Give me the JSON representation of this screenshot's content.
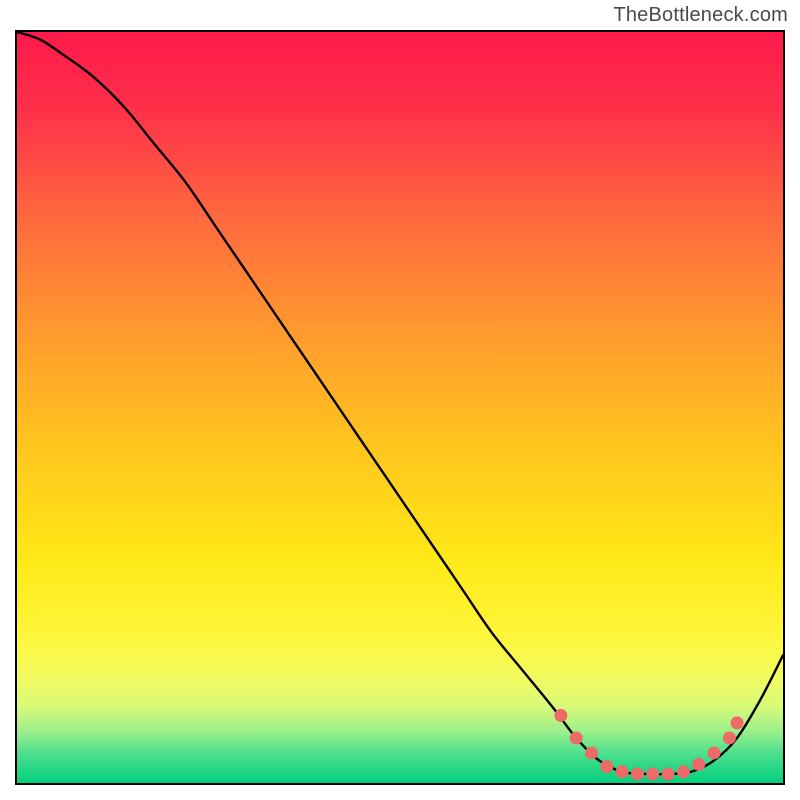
{
  "watermark": "TheBottleneck.com",
  "colors": {
    "curve": "#000000",
    "marker": "#ee6a66",
    "gradient_top": "#ff1a4b",
    "gradient_mid": "#ffe817",
    "gradient_bottom": "#00cf7d"
  },
  "chart_data": {
    "type": "line",
    "title": "",
    "xlabel": "",
    "ylabel": "",
    "xlim": [
      0,
      100
    ],
    "ylim": [
      0,
      100
    ],
    "grid": false,
    "legend": false,
    "series": [
      {
        "name": "bottleneck-curve",
        "x": [
          0,
          3,
          6,
          10,
          14,
          18,
          22,
          26,
          30,
          34,
          38,
          42,
          46,
          50,
          54,
          58,
          62,
          66,
          70,
          73,
          76,
          79,
          82,
          85,
          88,
          91,
          94,
          97,
          100
        ],
        "y": [
          100,
          99,
          97,
          94,
          90,
          85,
          80,
          74,
          68,
          62,
          56,
          50,
          44,
          38,
          32,
          26,
          20,
          15,
          10,
          6,
          3,
          1.5,
          1.2,
          1.2,
          1.5,
          3,
          6,
          11,
          17
        ]
      }
    ],
    "markers": {
      "series": "bottleneck-curve",
      "shape": "circle",
      "color": "#ee6a66",
      "points": [
        {
          "x": 71,
          "y": 9
        },
        {
          "x": 73,
          "y": 6
        },
        {
          "x": 75,
          "y": 4
        },
        {
          "x": 77,
          "y": 2.2
        },
        {
          "x": 79,
          "y": 1.5
        },
        {
          "x": 81,
          "y": 1.2
        },
        {
          "x": 83,
          "y": 1.2
        },
        {
          "x": 85,
          "y": 1.2
        },
        {
          "x": 87,
          "y": 1.5
        },
        {
          "x": 89,
          "y": 2.5
        },
        {
          "x": 91,
          "y": 4
        },
        {
          "x": 93,
          "y": 6
        },
        {
          "x": 94,
          "y": 8
        }
      ]
    }
  }
}
